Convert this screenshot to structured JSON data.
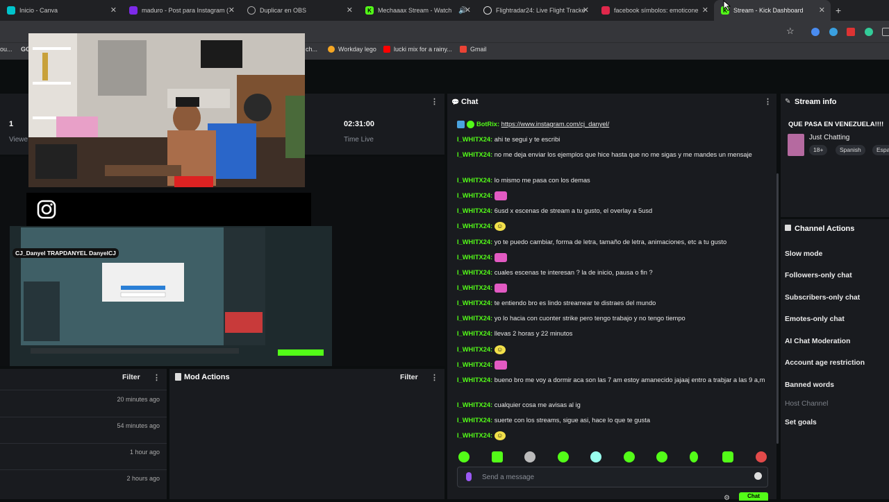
{
  "browser": {
    "tabs": [
      {
        "label": "Inicio - Canva",
        "color": "#00c4cc"
      },
      {
        "label": "maduro - Post para Instagram (",
        "color": "#7d2ae8"
      },
      {
        "label": "Duplicar en OBS",
        "color": "#aaaaaa"
      },
      {
        "label": "Mechaaax Stream - Watch",
        "color": "#53fc18"
      },
      {
        "label": "Flightradar24: Live Flight Tracke",
        "color": "#dddddd"
      },
      {
        "label": "facebook símbolos: emoticone",
        "color": "#e0284b"
      },
      {
        "label": "Stream - Kick Dashboard",
        "color": "#53fc18"
      }
    ],
    "bookmarks": [
      "ou...",
      "GG",
      "ch...",
      "Workday lego",
      "lucki mix for a rainy...",
      "Gmail"
    ]
  },
  "stats": {
    "viewers_value": "1",
    "viewers_label": "Viewe",
    "time_value": "02:31:00",
    "time_label": "Time Live"
  },
  "feed": {
    "filter": "Filter",
    "times": [
      "20 minutes ago",
      "54 minutes ago",
      "1 hour ago",
      "2 hours ago"
    ]
  },
  "mod_actions": {
    "title": "Mod Actions",
    "filter": "Filter"
  },
  "overlay": {
    "handles": "CJ_Danyel  TRAPDANYEL  DanyelCJ"
  },
  "chat": {
    "title": "Chat",
    "messages": [
      {
        "user": "BotRix:",
        "text": "https://www.instagram.com/cj_danyel/"
      },
      {
        "user": "I_WHITX24:",
        "text": "ahi te segui y te escribi"
      },
      {
        "user": "I_WHITX24:",
        "text": "no me deja enviar los ejemplos que hice hasta que no me sigas y me mandes un mensaje"
      },
      {
        "user": "I_WHITX24:",
        "text": "lo mismo me pasa con los demas"
      },
      {
        "user": "I_WHITX24:",
        "text": ""
      },
      {
        "user": "I_WHITX24:",
        "text": "6usd x escenas de stream a tu gusto, el overlay a 5usd"
      },
      {
        "user": "I_WHITX24:",
        "text": ""
      },
      {
        "user": "I_WHITX24:",
        "text": "yo te puedo cambiar, forma de letra, tamaño de letra, animaciones, etc a tu gusto"
      },
      {
        "user": "I_WHITX24:",
        "text": ""
      },
      {
        "user": "I_WHITX24:",
        "text": "cuales escenas te interesan ? la de inicio, pausa o fin ?"
      },
      {
        "user": "I_WHITX24:",
        "text": ""
      },
      {
        "user": "I_WHITX24:",
        "text": "te entiendo bro es lindo streamear te distraes del mundo"
      },
      {
        "user": "I_WHITX24:",
        "text": "yo lo hacia con cuonter strike pero tengo trabajo y no tengo tiempo"
      },
      {
        "user": "I_WHITX24:",
        "text": "llevas 2 horas y 22 minutos"
      },
      {
        "user": "I_WHITX24:",
        "text": ""
      },
      {
        "user": "I_WHITX24:",
        "text": ""
      },
      {
        "user": "I_WHITX24:",
        "text": "bueno bro me voy a dormir aca son las 7 am estoy amanecido jajaaj entro a trabjar a las 9 a,m"
      },
      {
        "user": "I_WHITX24:",
        "text": "cualquier cosa me avisas al ig"
      },
      {
        "user": "I_WHITX24:",
        "text": "suerte con los streams, sigue asi, hace lo que te gusta"
      },
      {
        "user": "I_WHITX24:",
        "text": ""
      }
    ],
    "send_placeholder": "Send a message",
    "chat_button": "Chat"
  },
  "stream_info": {
    "title": "Stream info",
    "stream_title": "QUE PASA EN VENEZUELA!!!!",
    "category": "Just Chatting",
    "tags": [
      "18+",
      "Spanish",
      "Españ"
    ]
  },
  "channel_actions": {
    "title": "Channel Actions",
    "items": [
      "Slow mode",
      "Followers-only chat",
      "Subscribers-only chat",
      "Emotes-only chat",
      "AI Chat Moderation",
      "Account age restriction",
      "Banned words",
      "Host Channel",
      "Set goals"
    ]
  },
  "colors": {
    "kick_green": "#53fc18",
    "panel": "#191b1f",
    "bg": "#0b0e0f"
  }
}
